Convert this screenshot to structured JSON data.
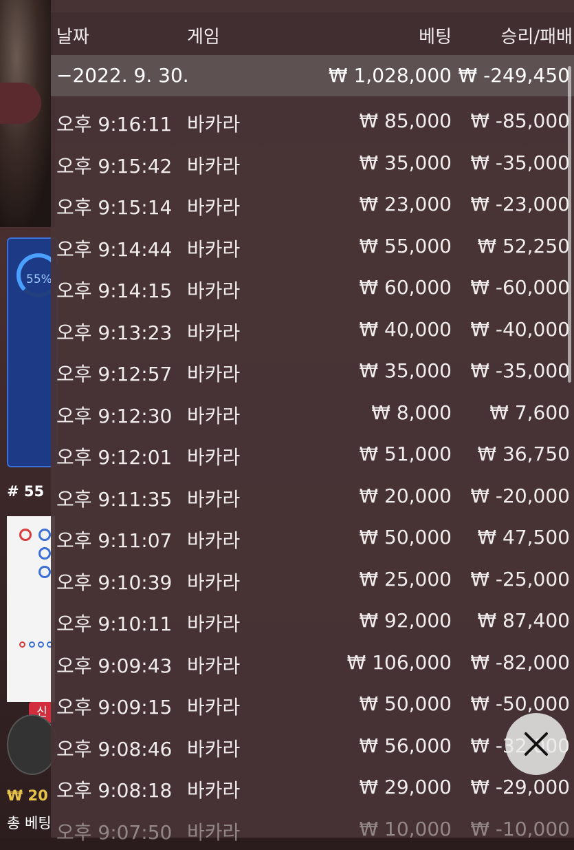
{
  "background": {
    "ring_percent": "55%",
    "round_label": "# 55",
    "new_badge": "신",
    "bottom_amount": "₩ 20",
    "bottom_label": "총 베팅"
  },
  "table": {
    "headers": {
      "date": "날짜",
      "game": "게임",
      "bet": "베팅",
      "win_loss": "승리/패배"
    },
    "day_summary": {
      "date": "−2022. 9. 30.",
      "bet": "₩ 1,028,000",
      "win_loss": "₩ -249,450"
    },
    "rows": [
      {
        "time": "오후 9:16:11",
        "game": "바카라",
        "bet": "₩ 85,000",
        "win_loss": "₩ -85,000"
      },
      {
        "time": "오후 9:15:42",
        "game": "바카라",
        "bet": "₩ 35,000",
        "win_loss": "₩ -35,000"
      },
      {
        "time": "오후 9:15:14",
        "game": "바카라",
        "bet": "₩ 23,000",
        "win_loss": "₩ -23,000"
      },
      {
        "time": "오후 9:14:44",
        "game": "바카라",
        "bet": "₩ 55,000",
        "win_loss": "₩ 52,250"
      },
      {
        "time": "오후 9:14:15",
        "game": "바카라",
        "bet": "₩ 60,000",
        "win_loss": "₩ -60,000"
      },
      {
        "time": "오후 9:13:23",
        "game": "바카라",
        "bet": "₩ 40,000",
        "win_loss": "₩ -40,000"
      },
      {
        "time": "오후 9:12:57",
        "game": "바카라",
        "bet": "₩ 35,000",
        "win_loss": "₩ -35,000"
      },
      {
        "time": "오후 9:12:30",
        "game": "바카라",
        "bet": "₩ 8,000",
        "win_loss": "₩ 7,600"
      },
      {
        "time": "오후 9:12:01",
        "game": "바카라",
        "bet": "₩ 51,000",
        "win_loss": "₩ 36,750"
      },
      {
        "time": "오후 9:11:35",
        "game": "바카라",
        "bet": "₩ 20,000",
        "win_loss": "₩ -20,000"
      },
      {
        "time": "오후 9:11:07",
        "game": "바카라",
        "bet": "₩ 50,000",
        "win_loss": "₩ 47,500"
      },
      {
        "time": "오후 9:10:39",
        "game": "바카라",
        "bet": "₩ 25,000",
        "win_loss": "₩ -25,000"
      },
      {
        "time": "오후 9:10:11",
        "game": "바카라",
        "bet": "₩ 92,000",
        "win_loss": "₩ 87,400"
      },
      {
        "time": "오후 9:09:43",
        "game": "바카라",
        "bet": "₩ 106,000",
        "win_loss": "₩ -82,000"
      },
      {
        "time": "오후 9:09:15",
        "game": "바카라",
        "bet": "₩ 50,000",
        "win_loss": "₩ -50,000"
      },
      {
        "time": "오후 9:08:46",
        "game": "바카라",
        "bet": "₩ 56,000",
        "win_loss": "₩ -32,000"
      },
      {
        "time": "오후 9:08:18",
        "game": "바카라",
        "bet": "₩ 29,000",
        "win_loss": "₩ -29,000"
      },
      {
        "time": "오후 9:07:50",
        "game": "바카라",
        "bet": "₩ 10,000",
        "win_loss": "₩ -10,000"
      }
    ]
  },
  "close_icon": "close-icon"
}
